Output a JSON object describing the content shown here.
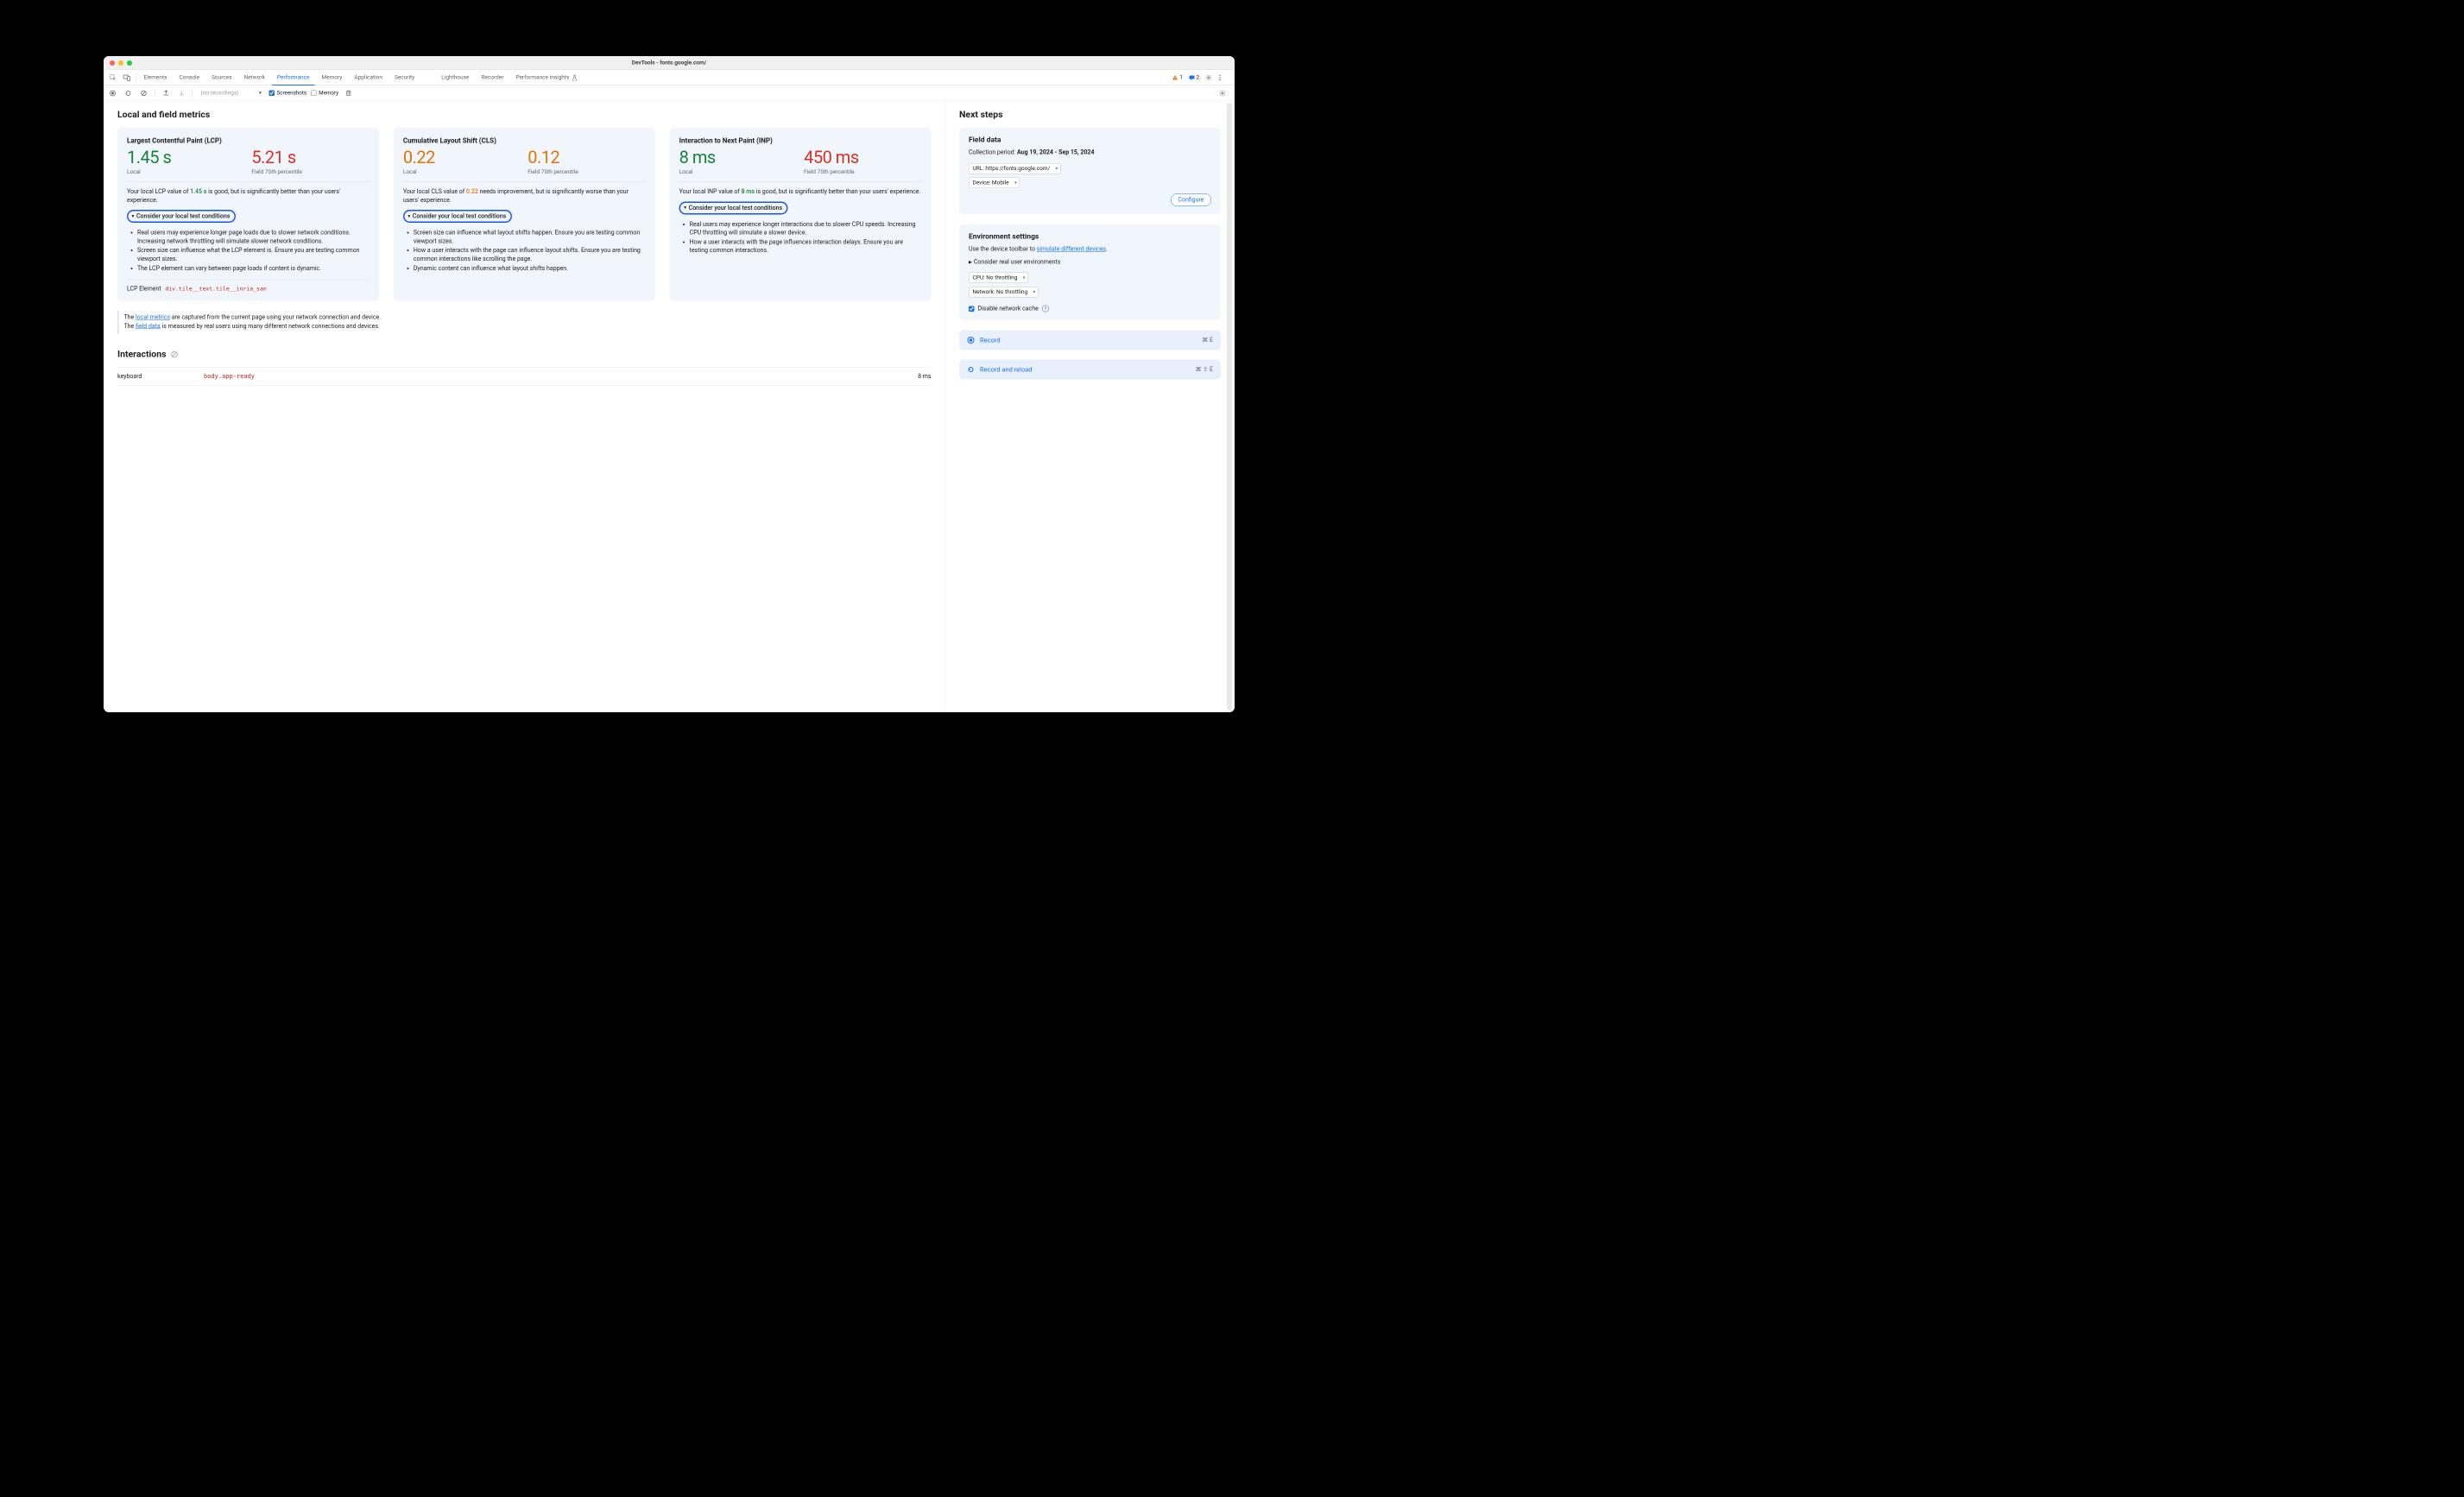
{
  "window": {
    "title": "DevTools - fonts.google.com/"
  },
  "tabs": {
    "items": [
      "Elements",
      "Console",
      "Sources",
      "Network",
      "Performance",
      "Memory",
      "Application",
      "Security",
      "Lighthouse",
      "Recorder",
      "Performance insights"
    ],
    "active": "Performance"
  },
  "badges": {
    "warnings": "1",
    "messages": "2"
  },
  "toolbar": {
    "recordings_placeholder": "(no recordings)",
    "screenshots_label": "Screenshots",
    "memory_label": "Memory"
  },
  "main": {
    "heading": "Local and field metrics",
    "cards": {
      "lcp": {
        "title": "Largest Contentful Paint (LCP)",
        "local_value": "1.45 s",
        "field_value": "5.21 s",
        "local_label": "Local",
        "field_label": "Field 75th percentile",
        "desc_prefix": "Your local LCP value of ",
        "desc_value": "1.45 s",
        "desc_suffix": " is good, but is significantly better than your users' experience.",
        "disclosure": "Consider your local test conditions",
        "bullets": [
          "Real users may experience longer page loads due to slower network conditions. Increasing network throttling will simulate slower network conditions.",
          "Screen size can influence what the LCP element is. Ensure you are testing common viewport sizes.",
          "The LCP element can vary between page loads if content is dynamic."
        ],
        "lcp_el_label": "LCP Element",
        "lcp_el_selector": "div.tile__text.tile__inria_san"
      },
      "cls": {
        "title": "Cumulative Layout Shift (CLS)",
        "local_value": "0.22",
        "field_value": "0.12",
        "local_label": "Local",
        "field_label": "Field 75th percentile",
        "desc_prefix": "Your local CLS value of ",
        "desc_value": "0.22",
        "desc_suffix": " needs improvement, but is significantly worse than your users' experience.",
        "disclosure": "Consider your local test conditions",
        "bullets": [
          "Screen size can influence what layout shifts happen. Ensure you are testing common viewport sizes.",
          "How a user interacts with the page can influence layout shifts. Ensure you are testing common interactions like scrolling the page.",
          "Dynamic content can influence what layout shifts happen."
        ]
      },
      "inp": {
        "title": "Interaction to Next Paint (INP)",
        "local_value": "8 ms",
        "field_value": "450 ms",
        "local_label": "Local",
        "field_label": "Field 75th percentile",
        "desc_prefix": "Your local INP value of ",
        "desc_value": "8 ms",
        "desc_suffix": " is good, but is significantly better than your users' experience.",
        "disclosure": "Consider your local test conditions",
        "bullets": [
          "Real users may experience longer interactions due to slower CPU speeds. Increasing CPU throttling will simulate a slower device.",
          "How a user interacts with the page influences interaction delays. Ensure you are testing common interactions."
        ]
      }
    },
    "note": {
      "p1a": "The ",
      "p1link": "local metrics",
      "p1b": " are captured from the current page using your network connection and device.",
      "p2a": "The ",
      "p2link": "field data",
      "p2b": " is measured by real users using many different network connections and devices."
    },
    "interactions": {
      "heading": "Interactions",
      "rows": [
        {
          "type": "keyboard",
          "target": "body.app-ready",
          "duration": "8 ms"
        }
      ]
    }
  },
  "side": {
    "heading": "Next steps",
    "field": {
      "title": "Field data",
      "period_label": "Collection period: ",
      "period_value": "Aug 19, 2024 - Sep 15, 2024",
      "url_select": "URL: https://fonts.google.com/",
      "device_select": "Device: Mobile",
      "configure": "Configure"
    },
    "env": {
      "title": "Environment settings",
      "hint_a": "Use the device toolbar to ",
      "hint_link": "simulate different devices",
      "hint_b": ".",
      "disclosure": "Consider real user environments",
      "cpu_select": "CPU: No throttling",
      "net_select": "Network: No throttling",
      "cache_label": "Disable network cache"
    },
    "actions": {
      "record": {
        "label": "Record",
        "shortcut": "⌘ E"
      },
      "reload": {
        "label": "Record and reload",
        "shortcut": "⌘ ⇧ E"
      }
    }
  }
}
